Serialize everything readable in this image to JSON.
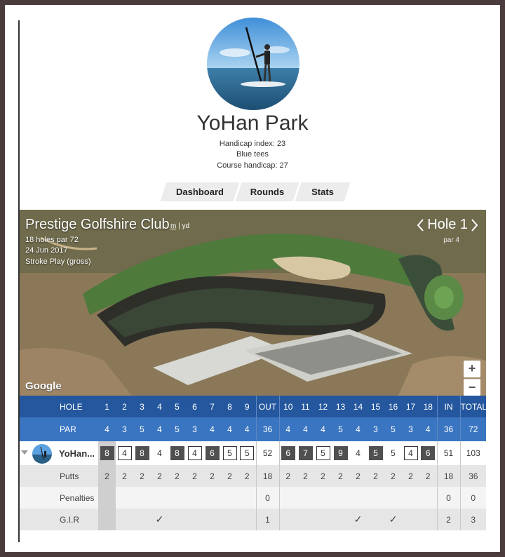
{
  "profile": {
    "name": "YoHan Park",
    "handicap_index": "Handicap index: 23",
    "tees": "Blue tees",
    "course_handicap": "Course handicap: 27"
  },
  "tabs": [
    "Dashboard",
    "Rounds",
    "Stats"
  ],
  "course": {
    "club": "Prestige Golfshire Club",
    "unit_m": "m",
    "unit_sep": "|",
    "unit_yd": "yd",
    "holes_par": "18 holes par 72",
    "date": "24 Jun 2017",
    "format": "Stroke Play (gross)",
    "hole_label": "Hole 1",
    "par_label": "par 4",
    "google": "Google",
    "zoom_in": "+",
    "zoom_out": "−"
  },
  "scorecard": {
    "hole_label": "HOLE",
    "par_label": "PAR",
    "holes": [
      "1",
      "2",
      "3",
      "4",
      "5",
      "6",
      "7",
      "8",
      "9",
      "OUT",
      "10",
      "11",
      "12",
      "13",
      "14",
      "15",
      "16",
      "17",
      "18",
      "IN",
      "TOTAL"
    ],
    "par": [
      "4",
      "3",
      "5",
      "4",
      "5",
      "3",
      "4",
      "4",
      "4",
      "36",
      "4",
      "4",
      "4",
      "5",
      "4",
      "3",
      "5",
      "3",
      "4",
      "36",
      "72"
    ],
    "player_name": "YoHan...",
    "scores": [
      "8",
      "4",
      "8",
      "4",
      "8",
      "4",
      "6",
      "5",
      "5",
      "52",
      "6",
      "7",
      "5",
      "9",
      "4",
      "5",
      "5",
      "4",
      "6",
      "51",
      "103"
    ],
    "score_style": [
      "dark",
      "box",
      "dark",
      "plain",
      "dark",
      "box",
      "dark",
      "box",
      "box",
      "total",
      "dark",
      "dark",
      "box",
      "dark",
      "plain",
      "dark",
      "plain",
      "box",
      "dark",
      "total",
      "total"
    ],
    "putts_label": "Putts",
    "putts": [
      "2",
      "2",
      "2",
      "2",
      "2",
      "2",
      "2",
      "2",
      "2",
      "18",
      "2",
      "2",
      "2",
      "2",
      "2",
      "2",
      "2",
      "2",
      "2",
      "18",
      "36"
    ],
    "penalties_label": "Penalties",
    "penalties": [
      "",
      "",
      "",
      "",
      "",
      "",
      "",
      "",
      "",
      "0",
      "",
      "",
      "",
      "",
      "",
      "",
      "",
      "",
      "",
      "0",
      "0"
    ],
    "gir_label": "G.I.R",
    "gir": [
      "",
      "",
      "",
      "✓",
      "",
      "",
      "",
      "",
      "",
      "1",
      "",
      "",
      "",
      "",
      "✓",
      "",
      "✓",
      "",
      "",
      "2",
      "3"
    ]
  }
}
